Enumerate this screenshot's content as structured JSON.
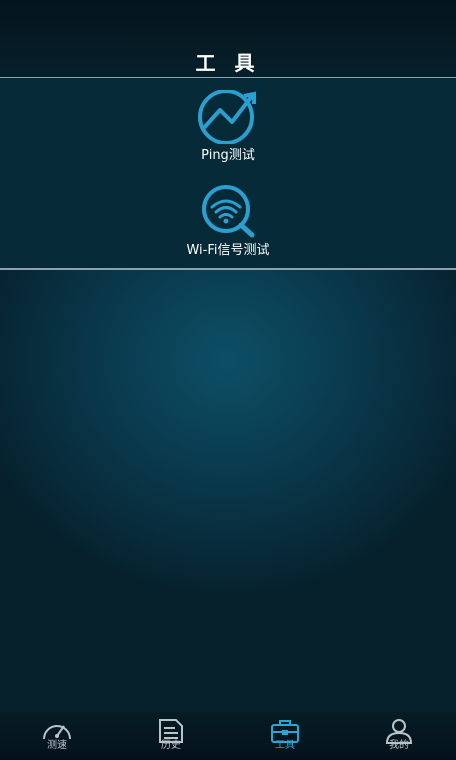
{
  "header": {
    "title": "工 具"
  },
  "tools": [
    {
      "label": "Ping测试",
      "icon": "ping-chart-icon"
    },
    {
      "label": "Wi-Fi信号测试",
      "icon": "wifi-search-icon"
    }
  ],
  "tabbar": {
    "tabs": [
      {
        "label": "测速",
        "icon": "speedometer-icon",
        "active": false
      },
      {
        "label": "历史",
        "icon": "document-icon",
        "active": false
      },
      {
        "label": "工具",
        "icon": "toolbox-icon",
        "active": true
      },
      {
        "label": "我的",
        "icon": "person-icon",
        "active": false
      }
    ]
  },
  "colors": {
    "accent": "#2aa6d6",
    "background": "#0a3d51",
    "divider": "#8aa3ad"
  }
}
